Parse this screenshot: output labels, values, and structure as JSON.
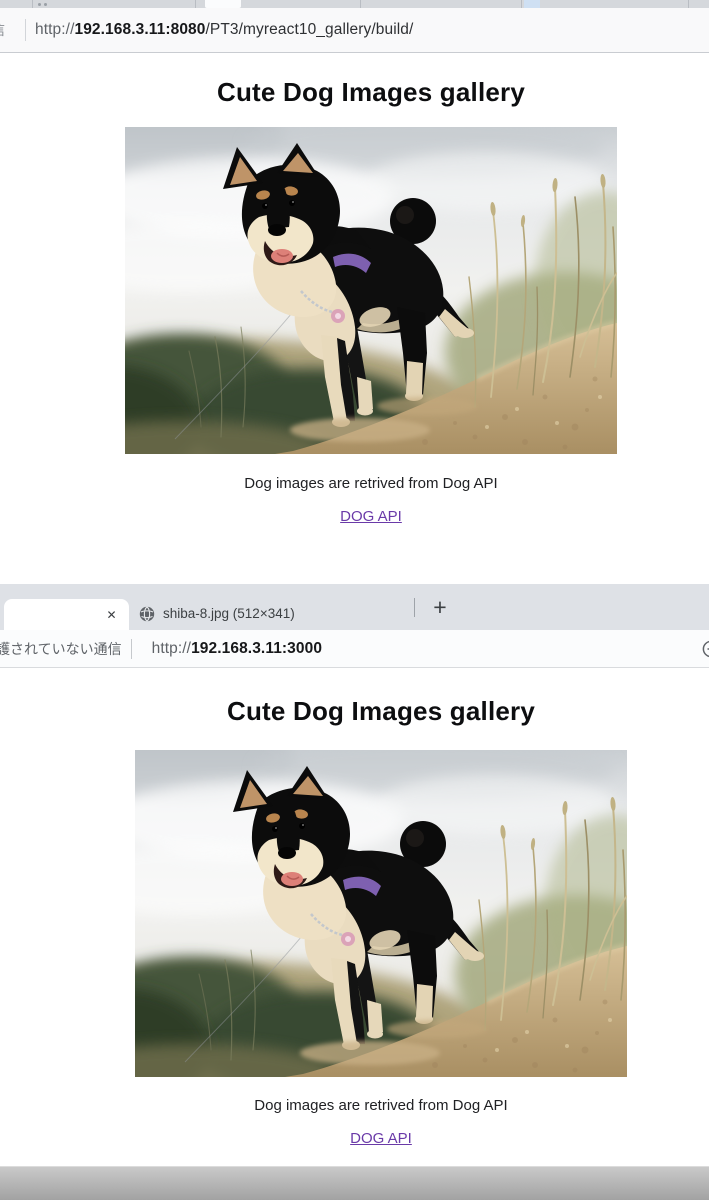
{
  "colors": {
    "link_purple": "#6a3aa8",
    "tab_strip_bg": "#dee1e6",
    "chrome_text": "#3c4043",
    "secondary_text": "#5f6368"
  },
  "top_window": {
    "address_bar": {
      "security_text_partial": "信",
      "url_scheme": "http://",
      "url_host": "192.168.3.11:8080",
      "url_path": "/PT3/myreact10_gallery/build/"
    },
    "page": {
      "title": "Cute Dog Images gallery",
      "caption": "Dog images are retrived from Dog API",
      "link_label": "DOG API"
    }
  },
  "bottom_window": {
    "tabs": {
      "close_glyph": "✕",
      "image_tab": {
        "favicon": "globe-icon",
        "title": "shiba-8.jpg (512×341)"
      },
      "new_tab_glyph": "+"
    },
    "address_bar": {
      "security_text": "護されていない通信",
      "url_scheme": "http://",
      "url_host": "192.168.3.11:3000",
      "zoom_icon": "zoom-out-icon"
    },
    "page": {
      "title": "Cute Dog Images gallery",
      "caption": "Dog images are retrived from Dog API",
      "link_label": "DOG API"
    }
  }
}
